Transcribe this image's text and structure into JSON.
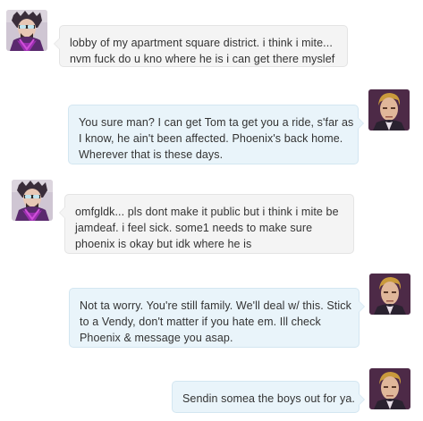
{
  "participants": {
    "left_avatar_icon": "purple-haired-character-avatar-icon",
    "right_avatar_icon": "blond-man-portrait-avatar-icon"
  },
  "messages": [
    {
      "side": "left",
      "lines": [
        "lobby of my apartment square district. i think i mite...",
        "nvm fuck do u kno where he is i can get there myslef"
      ]
    },
    {
      "side": "right",
      "lines": [
        "You sure man? I can get Tom ta get you a ride, s'far as",
        "I know, he ain't been affected. Phoenix's back home.",
        "Wherever that is these days."
      ]
    },
    {
      "side": "left",
      "lines": [
        "omfgldk... pls dont make it public but i think i mite be",
        "jamdeaf. i feel sick. some1 needs to make sure",
        "phoenix is okay but idk where he is"
      ]
    },
    {
      "side": "right",
      "lines": [
        "Not ta worry. You're still family. We'll deal w/ this. Stick",
        "to a Vendy, don't matter if you hate em. Ill check",
        "Phoenix & message you asap."
      ]
    },
    {
      "side": "right",
      "lines": [
        "Sendin somea the boys out for ya."
      ]
    }
  ],
  "colors": {
    "left_bubble": "#f4f4f4",
    "right_bubble": "#e9f4fa",
    "text": "#333333"
  }
}
